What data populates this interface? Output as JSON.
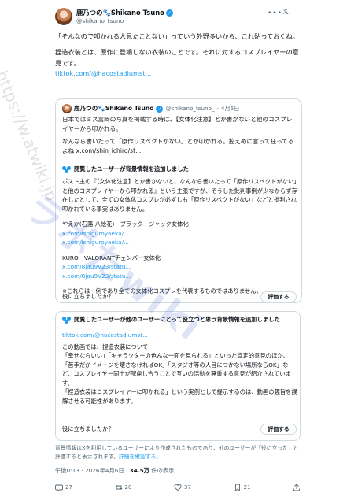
{
  "post": {
    "display_name": "鹿乃つの🐾Shikano Tsuno",
    "handle": "@shikano_tsuno_",
    "more_label": "•••",
    "paragraph1": "「そんなので叩かれる人見たことない」っていう外野多いから、これ貼っておくね。",
    "paragraph2": "捏造衣装とは、原作に登場しない衣装のことです。それに対するコスプレイヤーの意見です。",
    "link": "tiktok.com/@hacostadiumst..."
  },
  "quote": {
    "display_name": "鹿乃つの🐾Shikano Tsuno",
    "handle": "@shikano_tsuno_",
    "dot": "·",
    "date": "4月5日",
    "paragraph1": "日本ではミス冨岡の写真を掲載する時は、【女体化注意】とか書かないと他のコスプレイヤーから叩かれる。",
    "paragraph2": "なんなら書いたって「原作リスペクトがない」とか叩かれる。控えめに言って狂ってるよね x.com/shin_ichiro/st..."
  },
  "note1": {
    "header": "閲覧したユーザーが背景情報を追加しました",
    "body1": "ポスト主の『【女体化注意】とか書かないと、なんなら書いたって「原作リスペクトがない」と他のコスプレイヤーから叩かれる』という主張ですが、そうした批判事例が少なからず存在したとして、全ての女体化コスプレが必ずしも「原作リスペクトがない」などと批判され叩かれている事実はありません。",
    "ex1_title": "やえか(石蕗 八絵花)－ブラック・ジャック女体化",
    "ex1_link1": "x.com/ishiguroyaeka/...",
    "ex1_link2": "x.com/ishiguroyaeka/...",
    "ex2_title": "KURO－VALORANTチェンバー女体化",
    "ex2_link1": "x.com/8jau9V23/statu...",
    "ex2_link2": "x.com/8jau9V23/statu...",
    "footnote": "※これらは一例であり全ての女体化コスプレを代表するものではありません。",
    "question": "役に立ちましたか？",
    "rate": "評価する"
  },
  "note2": {
    "header": "閲覧したユーザーが他のユーザーにとって役立つと思う背景情報を追加しました",
    "link": "tiktok.com/@hacostadiumst...",
    "body1": "この動画では、捏造衣装について",
    "body2": "「幸せならいい」「キャラクターの色んな一面を見られる」といった肯定的意見のほか、",
    "body3": "「苦手だがイメージを壊さなければOK」「スタジオ等の人目につかない場所ならOK」など、コスプレイヤー同士が配慮し合うことで互いの活動を尊重する意見が紹介されています。",
    "body4": "「捏造衣装はコスプレイヤーに叩かれる」という実例として提示するのは、動画の趣旨を誤解させる可能性があります。",
    "question": "役に立ちましたか？",
    "rate": "評価する"
  },
  "disclaimer": {
    "text": "背景情報はXを利用しているユーザーにより作成されたものであり、他のユーザーが「役に立った」と評価すると表示されます。",
    "link": "詳細を確認する。"
  },
  "meta": {
    "time": "午後0:13 · 2026年4月6日 · ",
    "views_count": "34.5万",
    "views_label": " 件の表示"
  },
  "actions": {
    "reply_count": "27",
    "retweet_count": "20",
    "like_count": "37",
    "bookmark_count": "21"
  },
  "watermark": {
    "main": "ラポたwiki",
    "side": "https://w.atwiki.jp"
  },
  "colors": {
    "accent": "#1d9bf0",
    "text": "#0f1419",
    "muted": "#536471",
    "border": "#cfd9de"
  }
}
